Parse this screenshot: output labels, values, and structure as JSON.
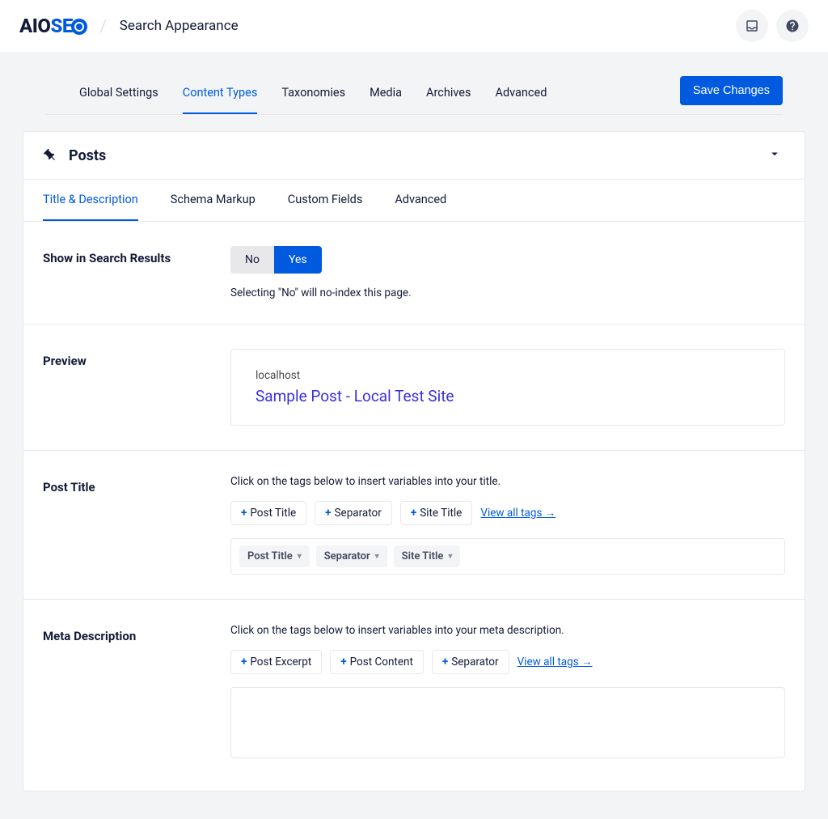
{
  "header": {
    "logo_a": "AIO",
    "logo_b": "SE",
    "breadcrumb": "Search Appearance"
  },
  "nav": {
    "tabs": [
      "Global Settings",
      "Content Types",
      "Taxonomies",
      "Media",
      "Archives",
      "Advanced"
    ],
    "save": "Save Changes"
  },
  "panel": {
    "title": "Posts",
    "inner_tabs": [
      "Title & Description",
      "Schema Markup",
      "Custom Fields",
      "Advanced"
    ]
  },
  "show_in_search": {
    "label": "Show in Search Results",
    "no": "No",
    "yes": "Yes",
    "hint": "Selecting \"No\" will no-index this page."
  },
  "preview": {
    "label": "Preview",
    "url": "localhost",
    "title": "Sample Post - Local Test Site"
  },
  "post_title": {
    "label": "Post Title",
    "hint": "Click on the tags below to insert variables into your title.",
    "tags": [
      "Post Title",
      "Separator",
      "Site Title"
    ],
    "view_all": "View all tags →",
    "pills": [
      "Post Title",
      "Separator",
      "Site Title"
    ]
  },
  "meta_desc": {
    "label": "Meta Description",
    "hint": "Click on the tags below to insert variables into your meta description.",
    "tags": [
      "Post Excerpt",
      "Post Content",
      "Separator"
    ],
    "view_all": "View all tags →"
  }
}
